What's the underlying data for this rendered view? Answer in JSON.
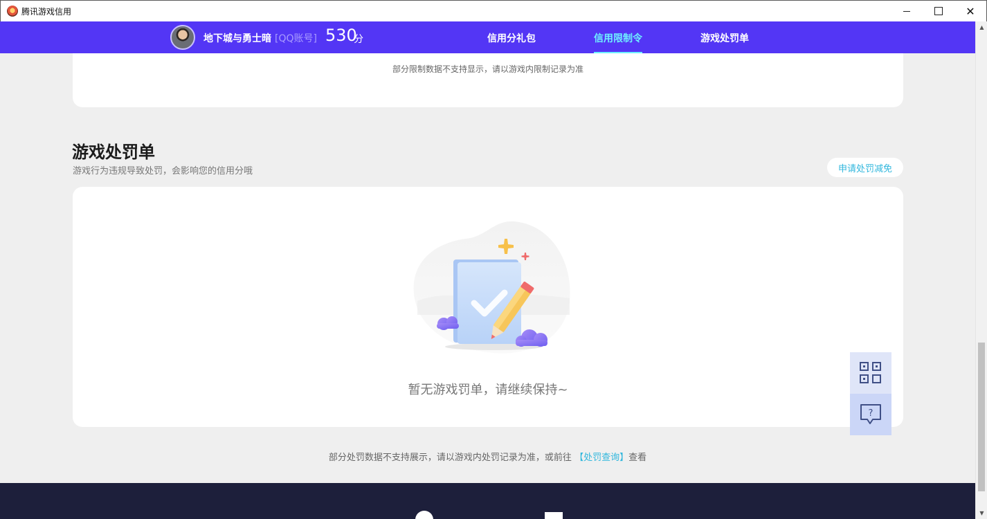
{
  "window": {
    "title": "腾讯游戏信用",
    "icon": "tencent-game-credit-app-icon",
    "controls": [
      "minimize-icon",
      "maximize-icon",
      "close-icon"
    ],
    "close_glyph": "✕"
  },
  "navbar": {
    "background": "#5336f5",
    "game_name": "地下城与勇士暗",
    "account_type": "[QQ账号]",
    "score": "530",
    "score_unit": "分",
    "tabs": [
      {
        "label": "信用分礼包",
        "active": false
      },
      {
        "label": "信用限制令",
        "active": true
      },
      {
        "label": "游戏处罚单",
        "active": false
      }
    ],
    "active_color": "#6ef0ff"
  },
  "restriction_section": {
    "note": "部分限制数据不支持显示，请以游戏内限制记录为准"
  },
  "penalty_section": {
    "title": "游戏处罚单",
    "subtitle": "游戏行为违规导致处罚，会影响您的信用分哦",
    "apply_button": "申请处罚减免",
    "empty_text": "暂无游戏罚单，请继续保持~",
    "empty_illustration": "notepad-pencil-illustration",
    "footer_note_prefix": "部分处罚数据不支持展示，请以游戏内处罚记录为准，或前往",
    "footer_link": "【处罚查询】",
    "footer_note_suffix": "查看"
  },
  "floating_buttons": [
    {
      "icon": "qr-code-icon"
    },
    {
      "icon": "help-question-icon",
      "glyph": "?"
    }
  ],
  "accent_color": "#31b7dd"
}
